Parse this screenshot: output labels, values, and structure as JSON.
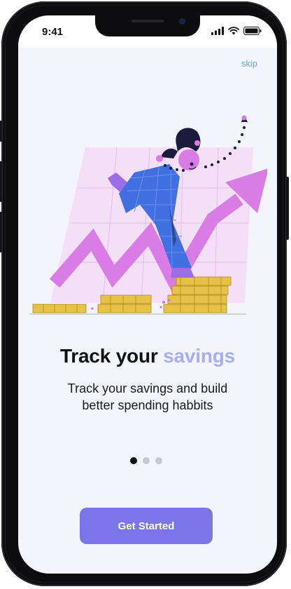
{
  "status_bar": {
    "time": "9:41"
  },
  "header": {
    "skip_label": "skip"
  },
  "content": {
    "title_main": "Track your",
    "title_accent": "savings",
    "subtitle_line1": "Track your savings and build",
    "subtitle_line2": "better spending habbits"
  },
  "pagination": {
    "total": 3,
    "active_index": 0
  },
  "cta": {
    "label": "Get Started"
  },
  "colors": {
    "accent": "#a9aef0",
    "button": "#7a76ea",
    "arrow": "#d97ce6",
    "coins": "#e6c247",
    "character_suit": "#3f6fe0",
    "screen_background": "#f4f5fc"
  },
  "icons": [
    "signal-icon",
    "wifi-icon",
    "battery-icon"
  ]
}
